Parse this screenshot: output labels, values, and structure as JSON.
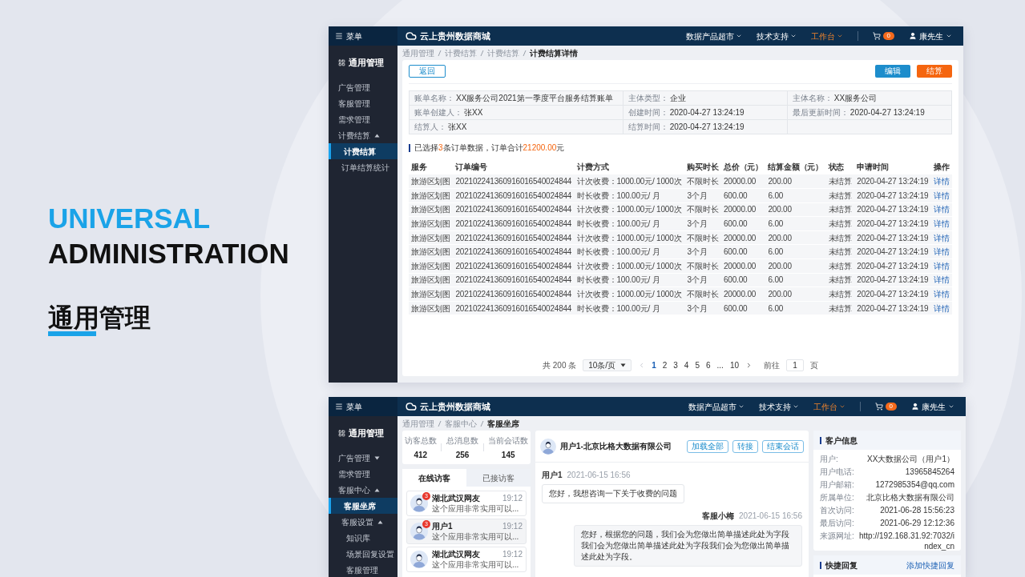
{
  "hero": {
    "line_1": "UNIVERSAL",
    "line_2": "ADMINISTRATION",
    "line_3": "通用管理"
  },
  "billing": {
    "topbar": {
      "menu_label": "菜单",
      "brand": "云上贵州数据商城",
      "nav": [
        {
          "label": "数据产品超市",
          "selected": false
        },
        {
          "label": "技术支持",
          "selected": false
        },
        {
          "label": "工作台",
          "selected": true
        }
      ],
      "cart_count": "0",
      "user": "康先生"
    },
    "sidebar": {
      "title": "通用管理",
      "items": [
        {
          "kind": "link",
          "label": "广告管理",
          "selected": false
        },
        {
          "kind": "link",
          "label": "客服管理",
          "selected": false
        },
        {
          "kind": "link",
          "label": "需求管理",
          "selected": false
        },
        {
          "kind": "group",
          "label": "计费结算",
          "selected": false,
          "expanded": true,
          "children": [
            {
              "kind": "link",
              "label": "计费结算",
              "selected": true
            },
            {
              "kind": "link",
              "label": "订单结算统计",
              "selected": false
            }
          ]
        }
      ]
    },
    "breadcrumb": [
      "通用管理",
      "计费结算",
      "计费结算",
      "计费结算详情"
    ],
    "back_button": "返回",
    "actions": [
      {
        "label": "编辑",
        "kind": "primary"
      },
      {
        "label": "结算",
        "kind": "warning"
      }
    ],
    "details": [
      {
        "label": "账单名称：",
        "value": "XX服务公司2021第一季度平台服务结算账单"
      },
      {
        "label": "主体类型：",
        "value": "企业"
      },
      {
        "label": "主体名称：",
        "value": "XX服务公司"
      },
      {
        "label": "账单创建人：",
        "value": "张XX"
      },
      {
        "label": "创建时间：",
        "value": "2020-04-27 13:24:19"
      },
      {
        "label": "最后更新时间：",
        "value": "2020-04-27 13:24:19"
      },
      {
        "label": "结算人：",
        "value": "张XX"
      },
      {
        "label": "结算时间：",
        "value": "2020-04-27 13:24:19"
      }
    ],
    "summary": [
      {
        "text": "已选择",
        "highlight": false
      },
      {
        "text": "3",
        "highlight": true
      },
      {
        "text": "条订单数据，订单合计",
        "highlight": false
      },
      {
        "text": "21200.00",
        "highlight": true
      },
      {
        "text": "元",
        "highlight": false
      }
    ],
    "table": {
      "columns": [
        "服务",
        "订单编号",
        "计费方式",
        "购买时长",
        "总价（元）",
        "结算金额（元）",
        "状态",
        "申请时间",
        "操作"
      ],
      "rows": [
        [
          "旅游区划图",
          "202102241360916016540024844",
          "计次收费：1000.00元/ 1000次",
          "不限时长",
          "20000.00",
          "200.00",
          "未结算",
          "2020-04-27 13:24:19",
          "详情"
        ],
        [
          "旅游区划图",
          "202102241360916016540024844",
          "时长收费：100.00元/ 月",
          "3个月",
          "600.00",
          "6.00",
          "未结算",
          "2020-04-27 13:24:19",
          "详情"
        ],
        [
          "旅游区划图",
          "202102241360916016540024844",
          "计次收费：1000.00元/ 1000次",
          "不限时长",
          "20000.00",
          "200.00",
          "未结算",
          "2020-04-27 13:24:19",
          "详情"
        ],
        [
          "旅游区划图",
          "202102241360916016540024844",
          "时长收费：100.00元/ 月",
          "3个月",
          "600.00",
          "6.00",
          "未结算",
          "2020-04-27 13:24:19",
          "详情"
        ],
        [
          "旅游区划图",
          "202102241360916016540024844",
          "计次收费：1000.00元/ 1000次",
          "不限时长",
          "20000.00",
          "200.00",
          "未结算",
          "2020-04-27 13:24:19",
          "详情"
        ],
        [
          "旅游区划图",
          "202102241360916016540024844",
          "时长收费：100.00元/ 月",
          "3个月",
          "600.00",
          "6.00",
          "未结算",
          "2020-04-27 13:24:19",
          "详情"
        ],
        [
          "旅游区划图",
          "202102241360916016540024844",
          "计次收费：1000.00元/ 1000次",
          "不限时长",
          "20000.00",
          "200.00",
          "未结算",
          "2020-04-27 13:24:19",
          "详情"
        ],
        [
          "旅游区划图",
          "202102241360916016540024844",
          "时长收费：100.00元/ 月",
          "3个月",
          "600.00",
          "6.00",
          "未结算",
          "2020-04-27 13:24:19",
          "详情"
        ],
        [
          "旅游区划图",
          "202102241360916016540024844",
          "计次收费：1000.00元/ 1000次",
          "不限时长",
          "20000.00",
          "200.00",
          "未结算",
          "2020-04-27 13:24:19",
          "详情"
        ],
        [
          "旅游区划图",
          "202102241360916016540024844",
          "时长收费：100.00元/ 月",
          "3个月",
          "600.00",
          "6.00",
          "未结算",
          "2020-04-27 13:24:19",
          "详情"
        ]
      ]
    },
    "pagination": {
      "total": "共 200 条",
      "page_size": "10条/页",
      "pages": [
        {
          "label": "1",
          "selected": true
        },
        {
          "label": "2",
          "selected": false
        },
        {
          "label": "3",
          "selected": false
        },
        {
          "label": "4",
          "selected": false
        },
        {
          "label": "5",
          "selected": false
        },
        {
          "label": "6",
          "selected": false
        },
        {
          "label": "...",
          "selected": false
        },
        {
          "label": "10",
          "selected": false
        }
      ],
      "goto_label": "前往",
      "goto_value": "1",
      "goto_suffix": "页"
    }
  },
  "service": {
    "topbar": {
      "menu_label": "菜单",
      "brand": "云上贵州数据商城",
      "nav": [
        {
          "label": "数据产品超市",
          "selected": false
        },
        {
          "label": "技术支持",
          "selected": false
        },
        {
          "label": "工作台",
          "selected": true
        }
      ],
      "cart_count": "0",
      "user": "康先生"
    },
    "sidebar": {
      "title": "通用管理",
      "items": [
        {
          "kind": "group",
          "label": "广告管理",
          "selected": false,
          "expanded": false
        },
        {
          "kind": "link",
          "label": "需求管理",
          "selected": false
        },
        {
          "kind": "group",
          "label": "客服中心",
          "selected": false,
          "expanded": true,
          "children": [
            {
              "kind": "link",
              "label": "客服坐席",
              "selected": true
            },
            {
              "kind": "group",
              "label": "客服设置",
              "selected": false,
              "expanded": true,
              "children": [
                {
                  "kind": "link",
                  "label": "知识库",
                  "selected": false
                },
                {
                  "kind": "link",
                  "label": "场景回复设置",
                  "selected": false
                },
                {
                  "kind": "link",
                  "label": "客服管理",
                  "selected": false
                }
              ]
            }
          ]
        }
      ]
    },
    "breadcrumb": [
      "通用管理",
      "客服中心",
      "客服坐席"
    ],
    "stats": [
      {
        "label": "访客总数",
        "value": "412"
      },
      {
        "label": "总消息数",
        "value": "256"
      },
      {
        "label": "当前会话数",
        "value": "145"
      }
    ],
    "visitor_tabs": [
      {
        "label": "在线访客",
        "selected": true
      },
      {
        "label": "已接访客",
        "selected": false
      }
    ],
    "visitors": [
      {
        "name": "湖北武汉网友",
        "time": "19:12",
        "preview": "这个应用非常实用可以...",
        "unread": "3",
        "selected": false
      },
      {
        "name": "用户1",
        "time": "19:12",
        "preview": "这个应用非常实用可以...",
        "unread": "3",
        "selected": true
      },
      {
        "name": "湖北武汉网友",
        "time": "19:12",
        "preview": "这个应用非常实用可以...",
        "selected": false
      }
    ],
    "chat": {
      "title": "用户1-北京比格大数据有限公司",
      "buttons": [
        "加载全部",
        "转接",
        "结束会话"
      ],
      "messages": [
        {
          "kind": "incoming",
          "sender": "用户1",
          "time": "2021-06-15 16:56",
          "text": "您好，我想咨询一下关于收费的问题"
        },
        {
          "kind": "outgoing",
          "sender": "客服小梅",
          "time": "2021-06-15 16:56",
          "text": "您好，根据您的问题，我们会为您做出简单描述此处为字段我们会为您做出简单描述此处为字段我们会为您做出简单描述此处为字段。"
        }
      ]
    },
    "customer": {
      "title": "客户信息",
      "rows": [
        {
          "label": "用户:",
          "value": "XX大数据公司（用户1）"
        },
        {
          "label": "用户电话:",
          "value": "13965845264"
        },
        {
          "label": "用户邮箱:",
          "value": "1272985354@qq.com"
        },
        {
          "label": "所属单位:",
          "value": "北京比格大数据有限公司"
        },
        {
          "label": "首次访问:",
          "value": "2021-06-28 15:56:23"
        },
        {
          "label": "最后访问:",
          "value": "2021-06-29 12:12:36"
        },
        {
          "label": "来源网址:",
          "value": "http://192.168.31.92:7032/index_cn"
        }
      ]
    },
    "quick_reply": {
      "title": "快捷回复",
      "link": "添加快捷回复"
    }
  }
}
